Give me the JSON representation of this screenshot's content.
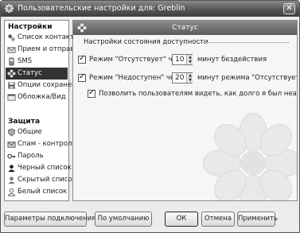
{
  "window": {
    "title": "Пользовательские настройки для: Greblin",
    "close_glyph": "✕"
  },
  "sidebar": {
    "settings_title": "Настройки",
    "settings_items": [
      {
        "label": "Список контактов",
        "icon": "contact-list-icon"
      },
      {
        "label": "Прием и отправка",
        "icon": "send-receive-icon"
      },
      {
        "label": "SMS",
        "icon": "sms-icon"
      },
      {
        "label": "Статус",
        "icon": "status-flower-icon",
        "selected": true
      },
      {
        "label": "Опции сохранения",
        "icon": "save-options-icon"
      },
      {
        "label": "Обложка/Вид",
        "icon": "skin-icon"
      }
    ],
    "security_title": "Защита",
    "security_items": [
      {
        "label": "Общие",
        "icon": "general-icon"
      },
      {
        "label": "Спам - контроль",
        "icon": "spam-control-icon"
      },
      {
        "label": "Пароль",
        "icon": "key-icon"
      },
      {
        "label": "Черный список",
        "icon": "black-list-icon"
      },
      {
        "label": "Скрытый список",
        "icon": "hidden-list-icon"
      },
      {
        "label": "Белый список",
        "icon": "white-list-icon"
      }
    ]
  },
  "panel": {
    "header_title": "Статус",
    "group_title": "Настройки состояния доступности",
    "row1": {
      "checked": true,
      "label": "Режим \"Отсутствует\" через",
      "value": "10",
      "suffix": "минут бездействия"
    },
    "row2": {
      "checked": true,
      "label": "Режим \"Недоступен\" через",
      "value": "20",
      "suffix": "минут режима \"Отсутствует\""
    },
    "row3": {
      "checked": true,
      "label": "Позволить пользователям видеть, как долго я был неактивен"
    }
  },
  "buttons": {
    "connection": "Параметры подключения",
    "defaults": "По умолчанию",
    "ok": "ОК",
    "cancel": "Отмена",
    "apply": "Применить"
  },
  "colors": {
    "selected_bg": "#333333",
    "header_bg": "#6e6e6e"
  }
}
